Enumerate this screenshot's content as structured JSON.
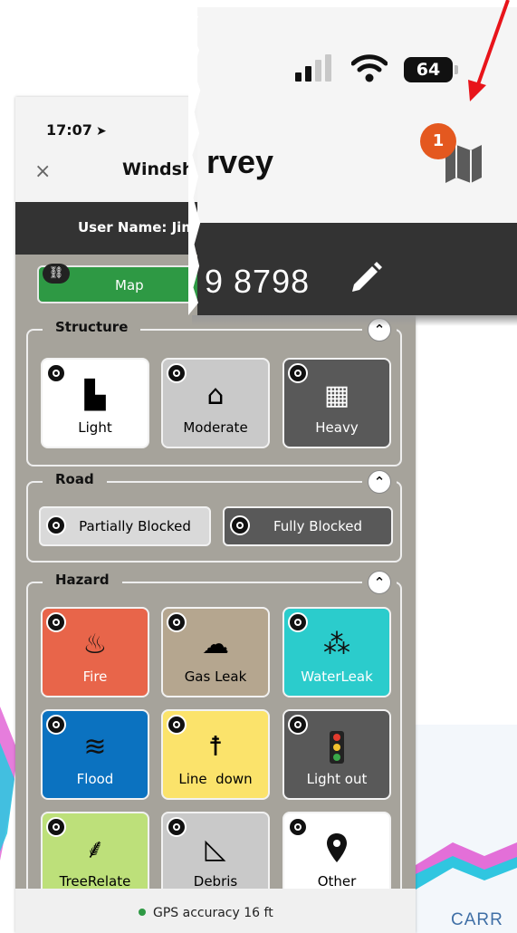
{
  "status": {
    "time": "17:07",
    "battery": "64"
  },
  "header": {
    "title_partial": "Windsh",
    "title_zoom_fragment": "rvey",
    "close_symbol": "×"
  },
  "user": {
    "label": "User Name: Jim",
    "phone_fragment": "9 8798"
  },
  "map_button": {
    "label": "Map"
  },
  "notification": {
    "count": "1"
  },
  "sections": {
    "structure": {
      "title": "Structure",
      "tiles": [
        {
          "label": "Light",
          "icon": "damaged-wall-icon",
          "color": "#ffffff"
        },
        {
          "label": "Moderate",
          "icon": "house-crack-icon",
          "color": "#c9c9c9"
        },
        {
          "label": "Heavy",
          "icon": "collapsed-building-icon",
          "color": "#595959"
        }
      ]
    },
    "road": {
      "title": "Road",
      "buttons": [
        {
          "label": "Partially Blocked",
          "color": "#d9d9d9"
        },
        {
          "label": "Fully Blocked",
          "color": "#595959"
        }
      ]
    },
    "hazard": {
      "title": "Hazard",
      "tiles": [
        {
          "label": "Fire",
          "icon": "fire-icon",
          "color": "#e8654a"
        },
        {
          "label": "Gas Leak",
          "icon": "gas-leak-icon",
          "color": "#b5a68f"
        },
        {
          "label": "WaterLeak",
          "icon": "water-leak-icon",
          "color": "#2bcccc"
        },
        {
          "label": "Flood",
          "icon": "flood-icon",
          "color": "#0b72c0"
        },
        {
          "label": "Line  down",
          "icon": "power-line-down-icon",
          "color": "#fbe36b"
        },
        {
          "label": "Light out",
          "icon": "traffic-light-icon",
          "color": "#595959"
        },
        {
          "label": "TreeRelate",
          "icon": "tree-fallen-icon",
          "color": "#bde07a"
        },
        {
          "label": "Debris",
          "icon": "debris-icon",
          "color": "#c9c9c9"
        },
        {
          "label": "Other",
          "icon": "location-pin-icon",
          "color": "#ffffff"
        }
      ]
    }
  },
  "gps": {
    "text": "GPS accuracy 16 ft"
  },
  "background_text": "CARR",
  "accent": {
    "arrow": "#e8141a",
    "badge": "#e4581f",
    "map_green": "#2e9944"
  }
}
